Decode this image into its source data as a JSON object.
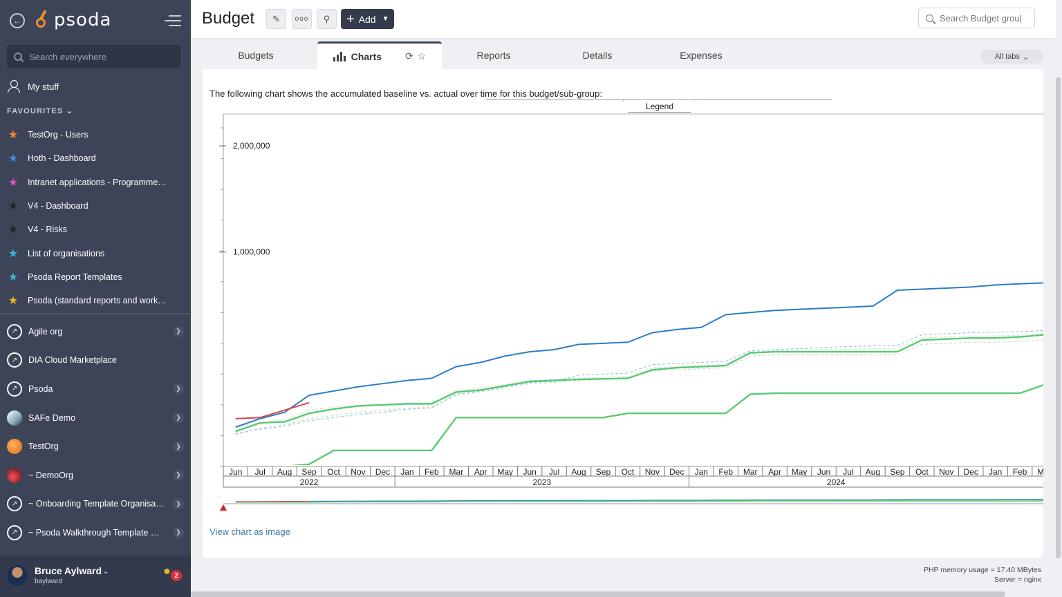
{
  "sidebar": {
    "logo": "psoda",
    "search_placeholder": "Search everywhere",
    "my_stuff": "My stuff",
    "favourites_header": "FAVOURITES",
    "favourites": [
      {
        "label": "TestOrg - Users",
        "color": "#f08c2a"
      },
      {
        "label": "Hoth - Dashboard",
        "color": "#3a8ee6"
      },
      {
        "label": "Intranet applications - Programme…",
        "color": "#d84fc8"
      },
      {
        "label": "V4 - Dashboard",
        "color": "#222222"
      },
      {
        "label": "V4 - Risks",
        "color": "#222222"
      },
      {
        "label": "List of organisations",
        "color": "#3ab8d8"
      },
      {
        "label": "Psoda Report Templates",
        "color": "#3ab8d8"
      },
      {
        "label": "Psoda (standard reports and work…",
        "color": "#f2b31b"
      }
    ],
    "orgs": [
      {
        "label": "Agile org",
        "icon": "plain",
        "has_children": true
      },
      {
        "label": "DIA Cloud Marketplace",
        "icon": "plain",
        "has_children": false
      },
      {
        "label": "Psoda",
        "icon": "plain",
        "has_children": true
      },
      {
        "label": "SAFe Demo",
        "icon": "safe",
        "has_children": true
      },
      {
        "label": "TestOrg",
        "icon": "orange",
        "has_children": true
      },
      {
        "label": "~ DemoOrg",
        "icon": "red",
        "has_children": true
      },
      {
        "label": "~ Onboarding Template Organisa…",
        "icon": "plain",
        "has_children": true
      },
      {
        "label": "~ Psoda Walkthrough Template P…",
        "icon": "plain",
        "has_children": true
      }
    ],
    "user": {
      "name": "Bruce Aylward",
      "username": "baylward",
      "notifications": "2"
    }
  },
  "header": {
    "title": "Budget",
    "add_label": "Add",
    "search_placeholder": "Search Budget grou|"
  },
  "tabs": {
    "items": [
      {
        "label": "Budgets",
        "active": false
      },
      {
        "label": "Charts",
        "active": true
      },
      {
        "label": "Reports",
        "active": false
      },
      {
        "label": "Details",
        "active": false
      },
      {
        "label": "Expenses",
        "active": false
      }
    ],
    "all_tabs": "All tabs"
  },
  "panel": {
    "intro": "The following chart shows the accumulated baseline vs. actual over time for this budget/sub-group:",
    "legend_label": "Legend",
    "view_chart_link": "View chart as image"
  },
  "footer": {
    "memory": "PHP memory usage = 17.40 MBytes",
    "server": "Server = nginx"
  },
  "chart_data": {
    "type": "line",
    "y_ticks": [
      {
        "value": 1000000,
        "label": "1,000,000"
      },
      {
        "value": 2000000,
        "label": "2,000,000"
      }
    ],
    "ylim": [
      -1020000,
      2170000
    ],
    "months": [
      "Jun",
      "Jul",
      "Aug",
      "Sep",
      "Oct",
      "Nov",
      "Dec",
      "Jan",
      "Feb",
      "Mar",
      "Apr",
      "May",
      "Jun",
      "Jul",
      "Aug",
      "Sep",
      "Oct",
      "Nov",
      "Dec",
      "Jan",
      "Feb",
      "Mar",
      "Apr",
      "May",
      "Jun",
      "Jul",
      "Aug",
      "Sep",
      "Oct",
      "Nov",
      "Dec",
      "Jan",
      "Feb",
      "Mar"
    ],
    "years": [
      {
        "label": "2022",
        "start": 0,
        "span": 7
      },
      {
        "label": "2023",
        "start": 7,
        "span": 12
      },
      {
        "label": "2024",
        "start": 19,
        "span": 12
      }
    ],
    "series": [
      {
        "color": "#2b7bcb",
        "width": 2,
        "dash": "",
        "values": [
          -650000,
          -570000,
          -510000,
          -350000,
          -310000,
          -270000,
          -240000,
          -210000,
          -190000,
          -80000,
          -40000,
          20000,
          60000,
          80000,
          130000,
          140000,
          150000,
          240000,
          270000,
          290000,
          410000,
          430000,
          450000,
          460000,
          470000,
          480000,
          490000,
          640000,
          650000,
          660000,
          670000,
          690000,
          700000,
          710000
        ]
      },
      {
        "color": "#e0404a",
        "width": 2,
        "dash": "",
        "values": [
          -570000,
          -560000,
          -490000,
          -420000
        ]
      },
      {
        "color": "#5ac873",
        "width": 2.4,
        "dash": "",
        "values": [
          -690000,
          -610000,
          -600000,
          -520000,
          -480000,
          -450000,
          -440000,
          -430000,
          -430000,
          -320000,
          -300000,
          -260000,
          -220000,
          -210000,
          -200000,
          -195000,
          -190000,
          -110000,
          -90000,
          -80000,
          -70000,
          50000,
          60000,
          60000,
          60000,
          60000,
          60000,
          60000,
          170000,
          180000,
          190000,
          190000,
          200000,
          220000
        ]
      },
      {
        "color": "#5ac873",
        "width": 2.4,
        "dash": "",
        "values": [
          -1020000,
          -1020000,
          -1020000,
          -1000000,
          -870000,
          -870000,
          -870000,
          -870000,
          -870000,
          -560000,
          -560000,
          -560000,
          -560000,
          -560000,
          -560000,
          -560000,
          -520000,
          -520000,
          -520000,
          -520000,
          -520000,
          -340000,
          -330000,
          -330000,
          -330000,
          -330000,
          -330000,
          -330000,
          -330000,
          -330000,
          -330000,
          -330000,
          -330000,
          -250000
        ]
      },
      {
        "color": "#8fb8e0",
        "width": 1,
        "dash": "4,3",
        "values": [
          -710000,
          -670000,
          -640000,
          -590000,
          -560000,
          -530000,
          -510000,
          -480000,
          -470000,
          -340000,
          -310000,
          -270000,
          -230000,
          -220000,
          -160000,
          -150000,
          -140000,
          -60000,
          -50000,
          -40000,
          -30000,
          70000,
          80000,
          90000,
          100000,
          110000,
          115000,
          120000,
          220000,
          230000,
          240000,
          245000,
          250000,
          260000
        ]
      },
      {
        "color": "#b9dcc0",
        "width": 1,
        "dash": "4,3",
        "values": [
          -720000,
          -660000,
          -630000,
          -570000,
          -540000,
          -510000,
          -490000,
          -470000,
          -460000,
          -350000,
          -320000,
          -280000,
          -240000,
          -230000,
          -210000,
          -200000,
          -190000,
          -120000,
          -110000,
          -100000,
          -90000,
          20000,
          30000,
          30000,
          30000,
          30000,
          30000,
          30000,
          130000,
          140000,
          150000,
          150000,
          160000,
          170000
        ]
      },
      {
        "color": "#c9e7cf",
        "width": 1,
        "dash": "4,3",
        "values": [
          -640000,
          -610000,
          -580000,
          -490000,
          -460000,
          -450000,
          -440000,
          -430000,
          -420000,
          -310000,
          -280000,
          -250000,
          -210000,
          -200000,
          -190000,
          -180000,
          -170000,
          -90000,
          -80000,
          -70000,
          -60000,
          60000,
          70000,
          75000,
          80000,
          85000,
          90000,
          95000,
          190000,
          200000,
          205000,
          210000,
          215000,
          230000
        ]
      }
    ]
  }
}
